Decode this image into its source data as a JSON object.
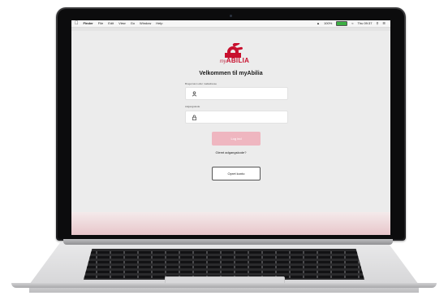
{
  "menubar": {
    "items": [
      "Finder",
      "File",
      "Edit",
      "View",
      "Go",
      "Window",
      "Help"
    ],
    "battery_percent": "100%",
    "clock": "Thu 09:37"
  },
  "app": {
    "brand_prefix": "my",
    "brand_name": "ABILIA",
    "title": "Velkommen til myAbilia",
    "username_label": "Brugernavn eller mailadresse",
    "password_label": "Adgangskode",
    "login_button": "Log ind",
    "forgot_link": "Glemt adgangskode?",
    "create_account_button": "Opret konto",
    "accent_color": "#c8102e",
    "login_button_color": "#efb6c0"
  },
  "icons": {
    "user": "user-icon",
    "lock": "lock-icon",
    "logo": "abilia-logo"
  }
}
